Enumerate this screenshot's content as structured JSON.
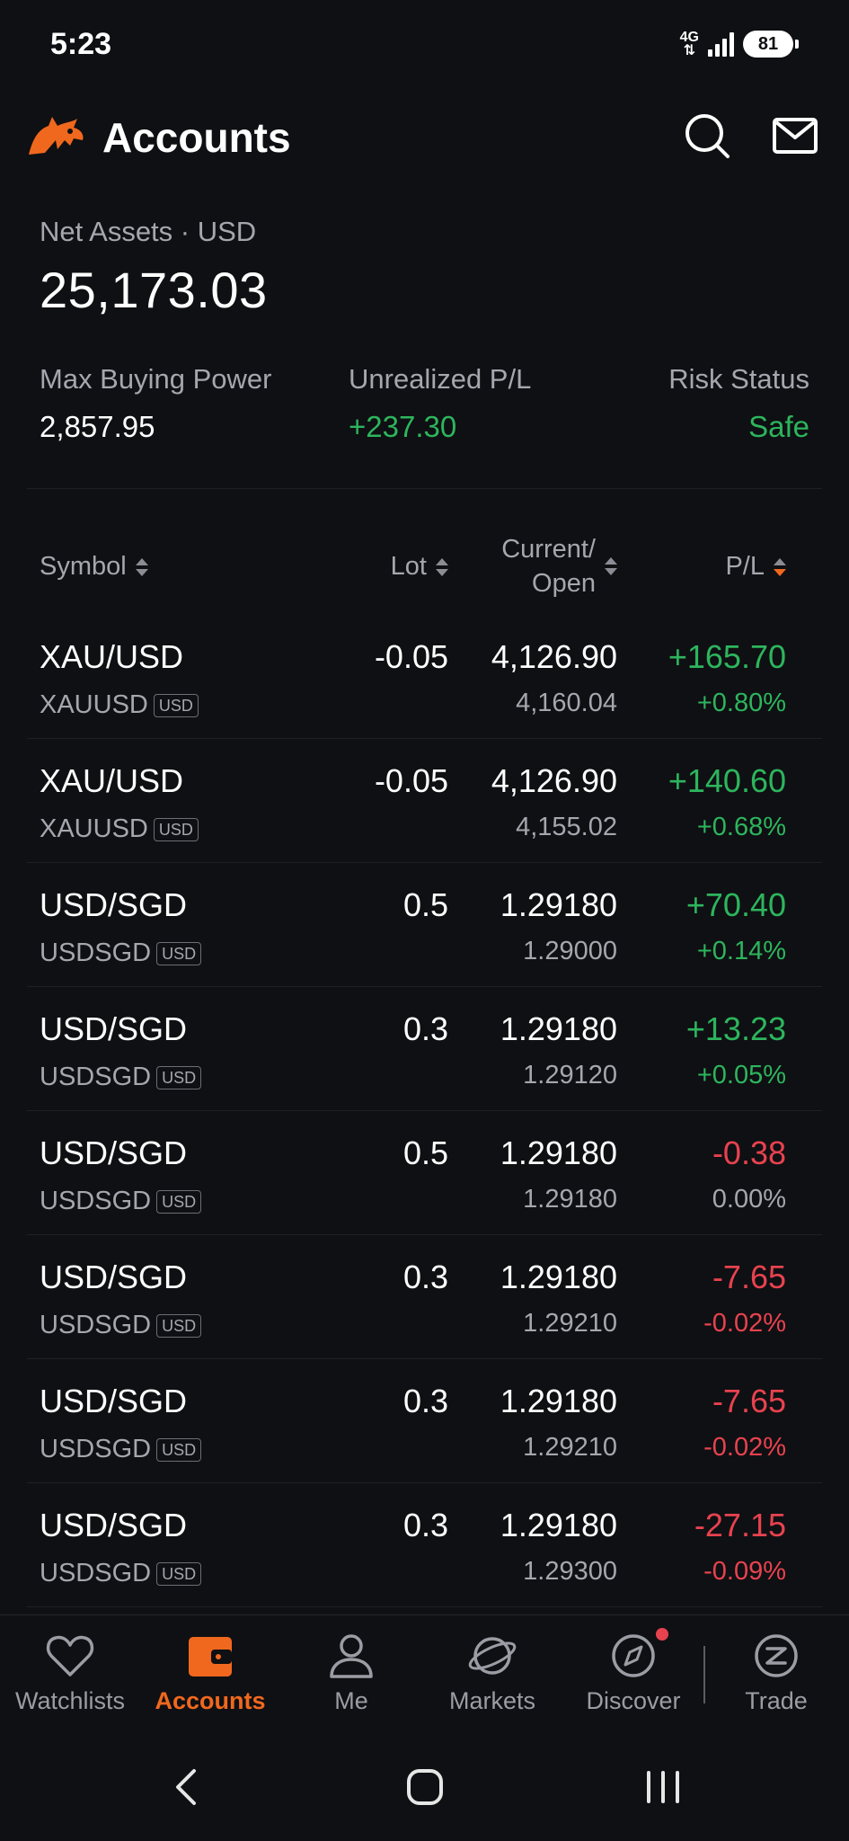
{
  "status_bar": {
    "time": "5:23",
    "network": "4G",
    "battery": "81"
  },
  "header": {
    "title": "Accounts"
  },
  "summary": {
    "net_assets_label": "Net Assets · USD",
    "net_assets_value": "25,173.03",
    "buying_power_label": "Max Buying Power",
    "buying_power_value": "2,857.95",
    "upl_label": "Unrealized P/L",
    "upl_value": "+237.30",
    "risk_label": "Risk Status",
    "risk_value": "Safe"
  },
  "columns": {
    "symbol": "Symbol",
    "lot": "Lot",
    "current_line1": "Current/",
    "current_line2": "Open",
    "pl": "P/L"
  },
  "positions": [
    {
      "symbol": "XAU/USD",
      "code": "XAUUSD",
      "ccy": "USD",
      "lot": "-0.05",
      "current": "4,126.90",
      "open": "4,160.04",
      "pl": "+165.70",
      "pct": "+0.80%",
      "dir": "pos"
    },
    {
      "symbol": "XAU/USD",
      "code": "XAUUSD",
      "ccy": "USD",
      "lot": "-0.05",
      "current": "4,126.90",
      "open": "4,155.02",
      "pl": "+140.60",
      "pct": "+0.68%",
      "dir": "pos"
    },
    {
      "symbol": "USD/SGD",
      "code": "USDSGD",
      "ccy": "USD",
      "lot": "0.5",
      "current": "1.29180",
      "open": "1.29000",
      "pl": "+70.40",
      "pct": "+0.14%",
      "dir": "pos"
    },
    {
      "symbol": "USD/SGD",
      "code": "USDSGD",
      "ccy": "USD",
      "lot": "0.3",
      "current": "1.29180",
      "open": "1.29120",
      "pl": "+13.23",
      "pct": "+0.05%",
      "dir": "pos"
    },
    {
      "symbol": "USD/SGD",
      "code": "USDSGD",
      "ccy": "USD",
      "lot": "0.5",
      "current": "1.29180",
      "open": "1.29180",
      "pl": "-0.38",
      "pct": "0.00%",
      "dir": "neg",
      "pct_dir": "zero"
    },
    {
      "symbol": "USD/SGD",
      "code": "USDSGD",
      "ccy": "USD",
      "lot": "0.3",
      "current": "1.29180",
      "open": "1.29210",
      "pl": "-7.65",
      "pct": "-0.02%",
      "dir": "neg"
    },
    {
      "symbol": "USD/SGD",
      "code": "USDSGD",
      "ccy": "USD",
      "lot": "0.3",
      "current": "1.29180",
      "open": "1.29210",
      "pl": "-7.65",
      "pct": "-0.02%",
      "dir": "neg"
    },
    {
      "symbol": "USD/SGD",
      "code": "USDSGD",
      "ccy": "USD",
      "lot": "0.3",
      "current": "1.29180",
      "open": "1.29300",
      "pl": "-27.15",
      "pct": "-0.09%",
      "dir": "neg"
    }
  ],
  "nav": {
    "watchlists": "Watchlists",
    "accounts": "Accounts",
    "me": "Me",
    "markets": "Markets",
    "discover": "Discover",
    "trade": "Trade"
  },
  "colors": {
    "accent": "#f0681e",
    "positive": "#2db55d",
    "negative": "#e8424f",
    "background": "#0f1013"
  },
  "icons": {
    "logo": "bull-logo-icon",
    "search": "search-icon",
    "mail": "mail-icon"
  }
}
